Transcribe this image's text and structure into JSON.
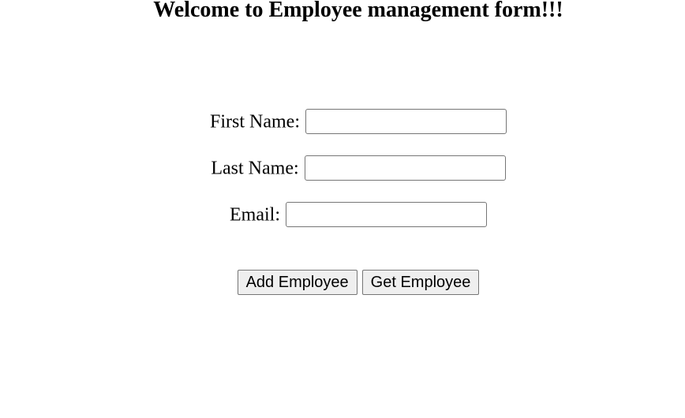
{
  "page": {
    "title": "Welcome to Employee management form!!!"
  },
  "form": {
    "first_name": {
      "label": "First Name:",
      "value": "",
      "placeholder": ""
    },
    "last_name": {
      "label": "Last Name:",
      "value": "",
      "placeholder": ""
    },
    "email": {
      "label": "Email:",
      "value": "",
      "placeholder": ""
    }
  },
  "buttons": {
    "add_label": "Add Employee",
    "get_label": "Get Employee"
  }
}
